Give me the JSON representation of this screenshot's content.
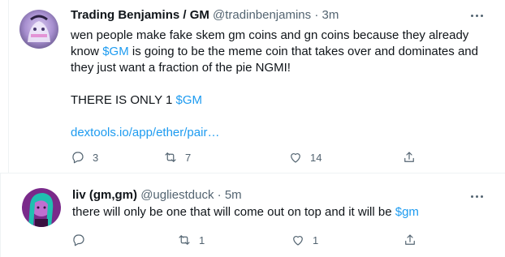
{
  "tweets": [
    {
      "author_name": "Trading Benjamins / GM",
      "handle": "@tradinbenjamins",
      "separator": "·",
      "time": "3m",
      "text": {
        "l1": "wen people make fake skem gm coins and gn coins because they already",
        "l2_pre": "know ",
        "l2_link": "$GM",
        "l2_post": " is going to be the meme coin that takes over and dominates and",
        "l3": "they just want a fraction of the pie NGMI!",
        "l4_pre": "THERE IS ONLY 1 ",
        "l4_link": "$GM",
        "url": "dextools.io/app/ether/pair…"
      },
      "replies": "3",
      "retweets": "7",
      "likes": "14"
    },
    {
      "author_name": "liv (gm,gm)",
      "handle": "@ugliestduck",
      "separator": "·",
      "time": "5m",
      "text": {
        "l1_pre": "there will only be one that will come out on top and it will be ",
        "l1_link": "$gm"
      },
      "replies": "",
      "retweets": "1",
      "likes": "1"
    }
  ],
  "colors": {
    "link": "#1d9bf0",
    "muted": "#536471",
    "text": "#0f1419",
    "divider": "#eff3f4"
  },
  "icons": [
    "reply-icon",
    "retweet-icon",
    "like-icon",
    "share-icon",
    "more-icon"
  ]
}
